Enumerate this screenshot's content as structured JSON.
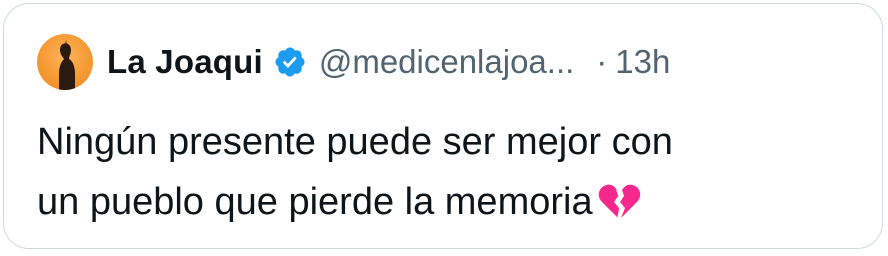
{
  "tweet": {
    "author_name": "La Joaqui",
    "handle": "@medicenlajoa...",
    "separator": "·",
    "time": "13h",
    "text_line_1": "Ningún presente puede ser mejor con",
    "text_line_2": "un pueblo que pierde la memoria",
    "emoji": "broken-heart-icon",
    "verified_badge": "verified-badge-icon"
  },
  "colors": {
    "badge": "#1d9bf0",
    "heart": "#f7288c",
    "text": "#0f1419",
    "secondary": "#536471",
    "border": "#cfd9de"
  }
}
